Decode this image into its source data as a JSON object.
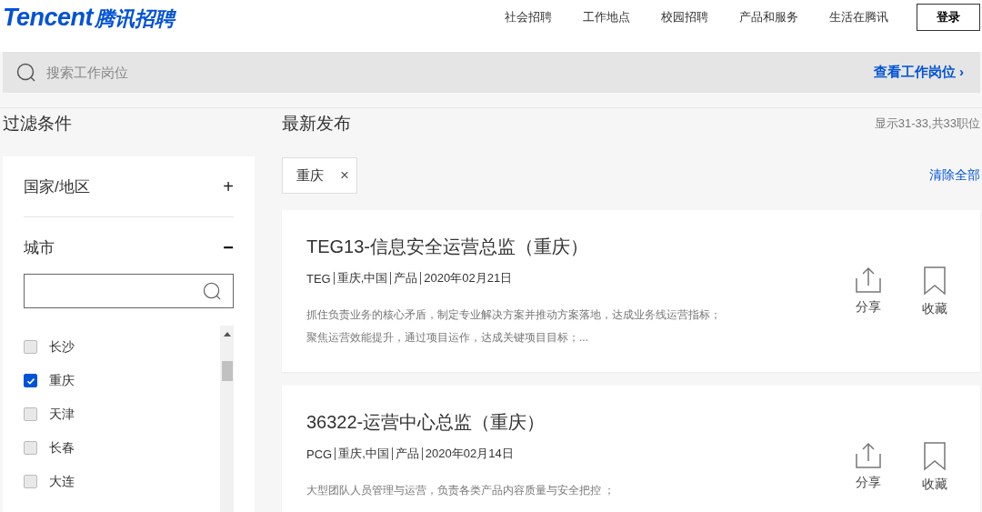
{
  "logo": {
    "brand": "Tencent",
    "name": "腾讯招聘"
  },
  "nav": [
    "社会招聘",
    "工作地点",
    "校园招聘",
    "产品和服务",
    "生活在腾讯"
  ],
  "login_button": "登录",
  "search": {
    "placeholder": "搜索工作岗位",
    "action": "查看工作岗位 ›"
  },
  "filters": {
    "title": "过滤条件",
    "sections": [
      {
        "label": "国家/地区",
        "expanded": false,
        "toggle": "+"
      },
      {
        "label": "城市",
        "expanded": true,
        "toggle": "−"
      }
    ],
    "cities": [
      {
        "label": "长沙",
        "checked": false
      },
      {
        "label": "重庆",
        "checked": true
      },
      {
        "label": "天津",
        "checked": false
      },
      {
        "label": "长春",
        "checked": false
      },
      {
        "label": "大连",
        "checked": false
      }
    ]
  },
  "results": {
    "title": "最新发布",
    "count": "显示31-33,共33职位",
    "tags": [
      {
        "label": "重庆",
        "remove": "×"
      }
    ],
    "clear_all": "清除全部",
    "jobs": [
      {
        "title": "TEG13-信息安全运营总监（重庆）",
        "meta": [
          "TEG",
          "重庆,中国",
          "产品",
          "2020年02月21日"
        ],
        "description": [
          "抓住负责业务的核心矛盾，制定专业解决方案并推动方案落地，达成业务线运营指标；",
          "聚焦运营效能提升，通过项目运作，达成关键项目目标；..."
        ],
        "share": "分享",
        "save": "收藏"
      },
      {
        "title": "36322-运营中心总监（重庆）",
        "meta": [
          "PCG",
          "重庆,中国",
          "产品",
          "2020年02月14日"
        ],
        "description": [
          "大型团队人员管理与运营，负责各类产品内容质量与安全把控 ；"
        ],
        "share": "分享",
        "save": "收藏"
      }
    ]
  }
}
